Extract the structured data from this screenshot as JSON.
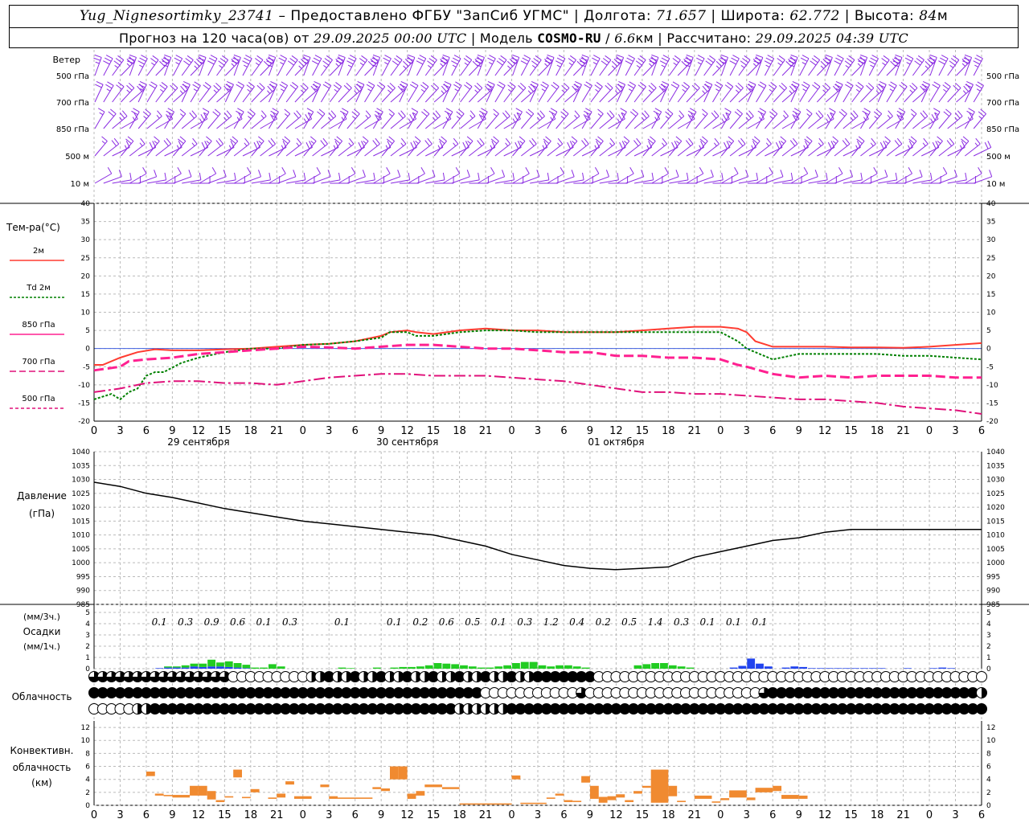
{
  "header": {
    "station": "Yug_Nignesortimky_23741",
    "provider": "– Предоставлено ФГБУ \"ЗапСиб УГМС\"",
    "lon_label": "Долгота:",
    "lon": "71.657",
    "lat_label": "Широта:",
    "lat": "62.772",
    "alt_label": "Высота:",
    "alt": "84",
    "alt_unit": "м",
    "fc_label": "Прогноз на 120 часа(ов) от",
    "fc_start": "29.09.2025 00:00 UTC",
    "model_label": "Модель",
    "model": "COSMO-RU",
    "res": "6.6",
    "res_unit": "км",
    "calc_label": "Рассчитано:",
    "calc_time": "29.09.2025 04:39 UTC"
  },
  "labels": {
    "wind_title": "Ветер",
    "wind_levels": [
      "500 гПа",
      "700 гПа",
      "850 гПа",
      "500 м",
      "10 м"
    ],
    "temp_title": "Тем-ра(°С)",
    "temp_legend": [
      "2м",
      "Td 2м",
      "850 гПа",
      "700 гПа",
      "500 гПа"
    ],
    "pressure_title": "Давление",
    "pressure_unit": "(гПа)",
    "precip_3h": "(мм/3ч.)",
    "precip_title": "Осадки",
    "precip_1h": "(мм/1ч.)",
    "cloud_title": "Облачность",
    "conv_title": "Конвективн.",
    "conv_title2": "облачность",
    "conv_unit": "(км)",
    "days": [
      "29 сентября",
      "30 сентября",
      "01 октября"
    ]
  },
  "colors": {
    "t2m": "#ff3b30",
    "td2m": "#008000",
    "t850": "#ff2090",
    "t700": "#e0107a",
    "t500": "#e0107a",
    "wind": "#8a2be2",
    "rain": "#22cc22",
    "snow": "#2244ee",
    "conv": "#f08a30"
  },
  "chart_data": [
    {
      "type": "line",
      "title": "Тем-ра(°С)",
      "x_hours": [
        0,
        3,
        6,
        9,
        12,
        15,
        18,
        21,
        24,
        27,
        30,
        33,
        36,
        39,
        42,
        45,
        48,
        51,
        54,
        57,
        60,
        63,
        66,
        69,
        72,
        75,
        78,
        81,
        84,
        87,
        90,
        93,
        96,
        99,
        102
      ],
      "x_tick_labels": [
        "0",
        "3",
        "6",
        "9",
        "12",
        "15",
        "18",
        "21",
        "0",
        "3",
        "6",
        "9",
        "12",
        "15",
        "18",
        "21",
        "0",
        "3",
        "6",
        "9",
        "12",
        "15",
        "18",
        "21",
        "0",
        "3",
        "6",
        "9",
        "12",
        "15",
        "18",
        "21",
        "0",
        "3",
        "6"
      ],
      "ylim": [
        -20,
        40
      ],
      "y_ticks": [
        -20,
        -15,
        -10,
        -5,
        0,
        5,
        10,
        15,
        20,
        25,
        30,
        35,
        40
      ],
      "series": [
        {
          "name": "2м",
          "x": [
            0,
            1,
            3,
            5,
            7,
            9,
            12,
            15,
            18,
            21,
            24,
            27,
            30,
            33,
            34,
            36,
            37,
            39,
            42,
            45,
            48,
            51,
            54,
            57,
            60,
            63,
            66,
            69,
            72,
            74,
            75,
            76,
            78,
            81,
            84,
            87,
            90,
            93,
            96,
            99,
            102
          ],
          "values": [
            -4.5,
            -4.5,
            -2.5,
            -1,
            -0.2,
            -0.5,
            -0.5,
            -0.2,
            0,
            0.5,
            1,
            1.3,
            2,
            3.5,
            4.5,
            5,
            4.5,
            4,
            5,
            5.5,
            5,
            5,
            4.5,
            4.5,
            4.5,
            5,
            5.5,
            6,
            6,
            5.5,
            4.5,
            2,
            0.5,
            0.5,
            0.5,
            0.3,
            0.3,
            0.2,
            0.5,
            1,
            1.5
          ]
        },
        {
          "name": "Td 2м",
          "x": [
            0,
            2,
            3,
            4,
            5,
            6,
            7,
            8,
            10,
            12,
            15,
            18,
            21,
            24,
            27,
            30,
            33,
            34,
            36,
            37,
            39,
            42,
            45,
            48,
            51,
            54,
            57,
            60,
            63,
            66,
            69,
            72,
            74,
            75,
            76,
            78,
            81,
            84,
            87,
            90,
            93,
            96,
            99,
            102
          ],
          "values": [
            -14,
            -12.5,
            -14,
            -12,
            -11,
            -7.5,
            -6.5,
            -6.5,
            -4,
            -2.5,
            -1,
            0,
            0,
            1,
            1.3,
            2,
            3,
            4.5,
            4.5,
            3.5,
            3.5,
            4.5,
            5,
            5,
            4.5,
            4.5,
            4.5,
            4.5,
            4.5,
            4.5,
            4.5,
            4.5,
            2,
            0,
            -1,
            -3,
            -1.5,
            -1.5,
            -1.5,
            -1.5,
            -2,
            -2,
            -2.5,
            -3
          ]
        },
        {
          "name": "850 гПа",
          "x": [
            0,
            3,
            4,
            6,
            9,
            12,
            15,
            18,
            21,
            24,
            27,
            30,
            33,
            36,
            39,
            42,
            45,
            48,
            51,
            54,
            57,
            60,
            63,
            66,
            69,
            72,
            74,
            75,
            78,
            81,
            84,
            87,
            90,
            93,
            96,
            99,
            102
          ],
          "values": [
            -6,
            -5,
            -3.5,
            -3,
            -2.5,
            -1.5,
            -1,
            -0.5,
            0,
            0.5,
            0.3,
            0,
            0.5,
            1,
            1,
            0.5,
            0,
            0,
            -0.5,
            -1,
            -1,
            -2,
            -2,
            -2.5,
            -2.5,
            -3,
            -4.5,
            -5,
            -7,
            -8,
            -7.5,
            -8,
            -7.5,
            -7.5,
            -7.5,
            -8,
            -8
          ]
        },
        {
          "name": "700 гПа",
          "x": [
            0,
            3,
            6,
            9,
            12,
            15,
            18,
            21,
            24,
            27,
            30,
            33,
            36,
            39,
            42,
            45,
            48,
            51,
            54,
            57,
            60,
            63,
            66,
            69,
            72,
            75,
            78,
            81,
            84,
            87,
            90,
            93,
            96,
            99,
            102
          ],
          "values": [
            -12,
            -11,
            -9.5,
            -9,
            -9,
            -9.5,
            -9.5,
            -10,
            -9,
            -8,
            -7.5,
            -7,
            -7,
            -7.5,
            -7.5,
            -7.5,
            -8,
            -8.5,
            -9,
            -10,
            -11,
            -12,
            -12,
            -12.5,
            -12.5,
            -13,
            -13.5,
            -14,
            -14,
            -14.5,
            -15,
            -16,
            -16.5,
            -17,
            -18
          ]
        }
      ]
    },
    {
      "type": "line",
      "title": "Давление",
      "ylabel": "(гПа)",
      "ylim": [
        985,
        1040
      ],
      "y_ticks": [
        985,
        990,
        995,
        1000,
        1005,
        1010,
        1015,
        1020,
        1025,
        1030,
        1035,
        1040
      ],
      "x_hours": [
        0,
        3,
        6,
        9,
        12,
        15,
        18,
        21,
        24,
        27,
        30,
        33,
        36,
        39,
        42,
        45,
        48,
        51,
        54,
        57,
        60,
        63,
        66,
        69,
        72,
        75,
        78,
        81,
        84,
        87,
        90,
        93,
        96,
        99,
        102
      ],
      "values": [
        1029,
        1027.5,
        1025,
        1023.5,
        1021.5,
        1019.5,
        1018,
        1016.5,
        1015,
        1014,
        1013,
        1012,
        1011,
        1010,
        1008,
        1006,
        1003,
        1001,
        999,
        998,
        997.5,
        998,
        998.5,
        1002,
        1004,
        1006,
        1008,
        1009,
        1011,
        1012,
        1012,
        1012,
        1012,
        1012,
        1012
      ]
    },
    {
      "type": "bar",
      "title": "Осадки",
      "ylabel": "(мм/3ч.)",
      "ylim": [
        0,
        5
      ],
      "x_hours": [
        0,
        3,
        6,
        9,
        12,
        15,
        18,
        21,
        24,
        27,
        30,
        33,
        36,
        39,
        42,
        45,
        48,
        51,
        54,
        57,
        60,
        63,
        66,
        69,
        72,
        75,
        78,
        81,
        84,
        87,
        90,
        93,
        96,
        99,
        102
      ],
      "precip_3h_labels": [
        "0.1",
        "0.3",
        "0.9",
        "0.6",
        "0.1",
        "0.3",
        "0.1",
        "0.1",
        "0.2",
        "0.6",
        "0.5",
        "0.1",
        "0.3",
        "1.2",
        "0.4",
        "0.2",
        "0.5",
        "1.4",
        "0.3",
        "0.1",
        "0.1",
        "0.1"
      ],
      "precip_3h_hours": [
        7.5,
        10.5,
        13.5,
        16.5,
        19.5,
        22.5,
        28.5,
        34.5,
        37.5,
        40.5,
        43.5,
        46.5,
        49.5,
        52.5,
        55.5,
        58.5,
        61.5,
        64.5,
        67.5,
        70.5,
        73.5,
        76.5
      ],
      "rain_1h": [
        0,
        0,
        0,
        0,
        0,
        0,
        0,
        0,
        0.1,
        0.1,
        0.2,
        0.25,
        0.3,
        0.6,
        0.35,
        0.5,
        0.4,
        0.3,
        0.1,
        0.1,
        0.4,
        0.2,
        0,
        0,
        0,
        0,
        0,
        0,
        0.1,
        0.05,
        0,
        0,
        0.1,
        0,
        0.1,
        0.15,
        0.15,
        0.2,
        0.3,
        0.5,
        0.45,
        0.4,
        0.3,
        0.2,
        0.1,
        0.1,
        0.2,
        0.3,
        0.5,
        0.6,
        0.6,
        0.3,
        0.2,
        0.3,
        0.3,
        0.2,
        0.1,
        0,
        0,
        0,
        0,
        0,
        0.3,
        0.4,
        0.5,
        0.5,
        0.3,
        0.2,
        0.1,
        0,
        0,
        0,
        0,
        0,
        0,
        0,
        0,
        0,
        0,
        0,
        0,
        0,
        0,
        0,
        0,
        0,
        0,
        0,
        0,
        0,
        0,
        0,
        0,
        0,
        0,
        0,
        0,
        0,
        0,
        0,
        0,
        0
      ],
      "snow_1h": [
        0,
        0,
        0,
        0,
        0,
        0,
        0,
        0.05,
        0.1,
        0.1,
        0.1,
        0.2,
        0.15,
        0.2,
        0.2,
        0.15,
        0.1,
        0.05,
        0,
        0,
        0,
        0,
        0,
        0,
        0,
        0,
        0,
        0,
        0,
        0,
        0,
        0,
        0,
        0,
        0,
        0,
        0,
        0,
        0,
        0,
        0,
        0,
        0,
        0,
        0,
        0,
        0,
        0,
        0,
        0,
        0,
        0,
        0,
        0,
        0,
        0,
        0,
        0,
        0,
        0,
        0,
        0,
        0,
        0,
        0,
        0,
        0,
        0,
        0,
        0,
        0,
        0,
        0,
        0.1,
        0.25,
        0.9,
        0.45,
        0.2,
        0,
        0.1,
        0.2,
        0.15,
        0.05,
        0.05,
        0.05,
        0.05,
        0.05,
        0.05,
        0.05,
        0.05,
        0.05,
        0,
        0,
        0.05,
        0,
        0,
        0.05,
        0.1,
        0.05,
        0
      ]
    },
    {
      "type": "bar",
      "title": "Конвективн. облачность",
      "ylabel": "(км)",
      "ylim": [
        0,
        13
      ],
      "y_ticks": [
        0,
        2,
        4,
        6,
        8,
        10,
        12
      ],
      "layers": [
        [
          6,
          7,
          4.5,
          5.2
        ],
        [
          7,
          8,
          1.5,
          1.8
        ],
        [
          8,
          9,
          1.4,
          1.6
        ],
        [
          9,
          11,
          1.2,
          1.6
        ],
        [
          11,
          12,
          1.5,
          3.0
        ],
        [
          12,
          13,
          1.5,
          3.0
        ],
        [
          13,
          14,
          0.9,
          2.2
        ],
        [
          14,
          15,
          0.5,
          0.8
        ],
        [
          15,
          16,
          1.2,
          1.4
        ],
        [
          16,
          17,
          4.3,
          5.5
        ],
        [
          17,
          18,
          1.1,
          1.3
        ],
        [
          18,
          19,
          2.0,
          2.5
        ],
        [
          20,
          21,
          1.0,
          1.2
        ],
        [
          21,
          22,
          1.2,
          1.8
        ],
        [
          22,
          23,
          3.2,
          3.7
        ],
        [
          23,
          25,
          1.0,
          1.4
        ],
        [
          26,
          27,
          2.8,
          3.2
        ],
        [
          27,
          28,
          1.0,
          1.4
        ],
        [
          28,
          32,
          1.0,
          1.2
        ],
        [
          32,
          33,
          2.5,
          2.8
        ],
        [
          33,
          34,
          2.2,
          2.6
        ],
        [
          34,
          35,
          4.0,
          6.0
        ],
        [
          35,
          36,
          4.0,
          6.0
        ],
        [
          36,
          37,
          1.0,
          1.8
        ],
        [
          37,
          38,
          1.5,
          2.2
        ],
        [
          38,
          40,
          2.8,
          3.2
        ],
        [
          40,
          42,
          2.5,
          2.8
        ],
        [
          42,
          48,
          0.1,
          0.3
        ],
        [
          48,
          49,
          4.0,
          4.6
        ],
        [
          49,
          52,
          0.2,
          0.4
        ],
        [
          52,
          53,
          1.0,
          1.2
        ],
        [
          53,
          54,
          1.5,
          1.8
        ],
        [
          54,
          55,
          0.5,
          0.8
        ],
        [
          55,
          56,
          0.5,
          0.7
        ],
        [
          56,
          57,
          3.5,
          4.5
        ],
        [
          57,
          58,
          1.0,
          3.0
        ],
        [
          58,
          59,
          0.4,
          1.3
        ],
        [
          59,
          60,
          0.8,
          1.4
        ],
        [
          60,
          61,
          1.2,
          1.7
        ],
        [
          61,
          62,
          0.5,
          0.8
        ],
        [
          62,
          63,
          1.8,
          2.2
        ],
        [
          63,
          64,
          2.7,
          3.0
        ],
        [
          64,
          66,
          0.4,
          5.5
        ],
        [
          66,
          67,
          1.4,
          3.0
        ],
        [
          67,
          68,
          0.5,
          0.7
        ],
        [
          69,
          71,
          1.0,
          1.5
        ],
        [
          71,
          72,
          0.4,
          0.6
        ],
        [
          72,
          73,
          0.8,
          1.1
        ],
        [
          73,
          75,
          1.2,
          2.3
        ],
        [
          75,
          76,
          0.8,
          1.2
        ],
        [
          76,
          78,
          2.0,
          2.7
        ],
        [
          78,
          79,
          2.2,
          3.0
        ],
        [
          79,
          81,
          1.0,
          1.6
        ],
        [
          81,
          82,
          1.0,
          1.5
        ]
      ]
    }
  ]
}
